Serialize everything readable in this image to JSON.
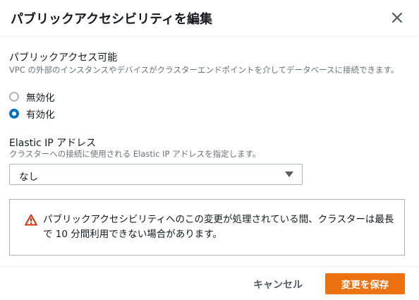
{
  "modal": {
    "title": "パブリックアクセシビリティを編集",
    "close_icon": "close-icon"
  },
  "public_access": {
    "label": "パブリックアクセス可能",
    "description": "VPC の外部のインスタンスやデバイスがクラスターエンドポイントを介してデータベースに接続できます。",
    "options": [
      {
        "label": "無効化",
        "selected": false
      },
      {
        "label": "有効化",
        "selected": true
      }
    ]
  },
  "elastic_ip": {
    "label": "Elastic IP アドレス",
    "description": "クラスターへの接続に使用される Elastic IP アドレスを指定します。",
    "selected_value": "なし"
  },
  "alert": {
    "icon": "warning-icon",
    "text": "パブリックアクセシビリティへのこの変更が処理されている間、クラスターは最長で 10 分間利用できない場合があります。"
  },
  "footer": {
    "cancel_label": "キャンセル",
    "save_label": "変更を保存"
  },
  "colors": {
    "primary_button": "#ec7211",
    "radio_selected": "#0073bb",
    "warning": "#d13212"
  }
}
